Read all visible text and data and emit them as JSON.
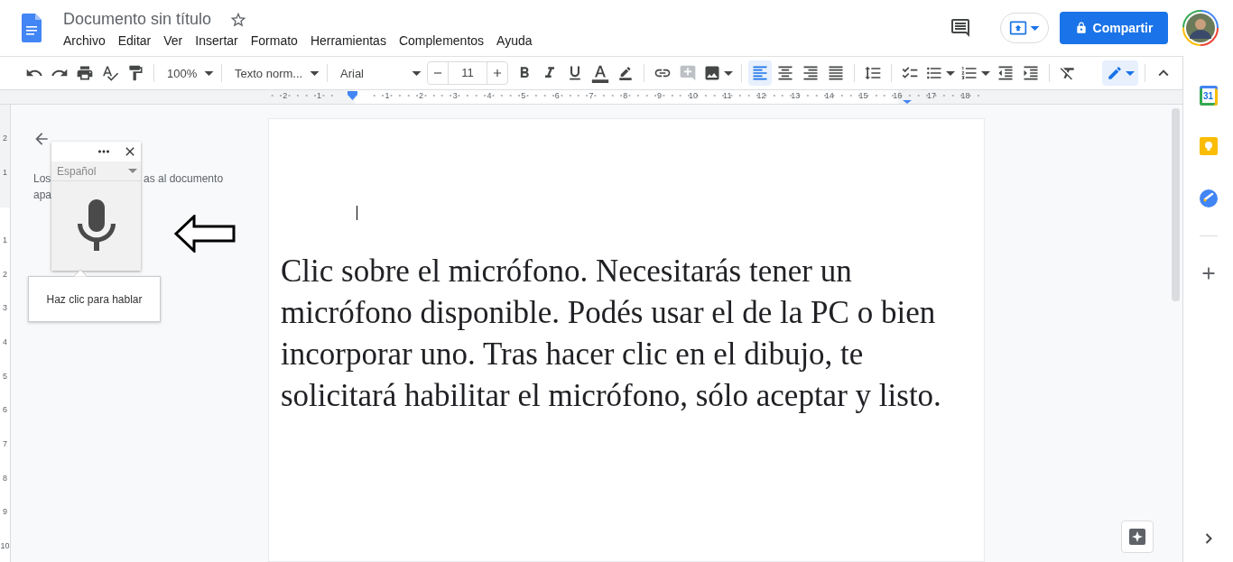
{
  "header": {
    "title": "Documento sin título",
    "starred": false,
    "menu": [
      "Archivo",
      "Editar",
      "Ver",
      "Insertar",
      "Formato",
      "Herramientas",
      "Complementos",
      "Ayuda"
    ],
    "share_button": "Compartir"
  },
  "toolbar": {
    "zoom": "100%",
    "style": "Texto norm...",
    "font": "Arial",
    "font_size": "11",
    "insert": [
      {
        "kind": "link",
        "disabled": false
      },
      {
        "kind": "comment",
        "disabled": true
      },
      {
        "kind": "image",
        "disabled": false
      }
    ],
    "alignment": [
      {
        "kind": "left",
        "selected": true
      },
      {
        "kind": "center",
        "selected": false
      },
      {
        "kind": "right",
        "selected": false
      },
      {
        "kind": "justify",
        "selected": false
      }
    ]
  },
  "ruler": {
    "left_numbers": [
      "2",
      "1"
    ],
    "right_numbers": [
      "1",
      "2",
      "3",
      "4",
      "5",
      "6",
      "7",
      "8",
      "9",
      "10",
      "11",
      "12",
      "13",
      "14",
      "15",
      "16",
      "17",
      "18"
    ],
    "top_numbers": [
      "2",
      "1"
    ],
    "bottom_numbers": [
      "1",
      "2",
      "3",
      "4",
      "5",
      "6",
      "7",
      "8",
      "9",
      "10"
    ]
  },
  "outline": {
    "lines": [
      [
        "Los",
        "as al documento"
      ],
      [
        "apa"
      ]
    ]
  },
  "voice_typing": {
    "language": "Español",
    "tooltip": "Haz clic para hablar"
  },
  "document": {
    "paragraph": "Clic sobre el micrófono. Necesitarás tener un micrófono disponible. Podés usar el de la PC o bien incorporar uno. Tras hacer clic en el dibujo, te solicitará habilitar el micrófono, sólo aceptar y listo."
  },
  "side_panel": {
    "calendar_day": "31"
  }
}
